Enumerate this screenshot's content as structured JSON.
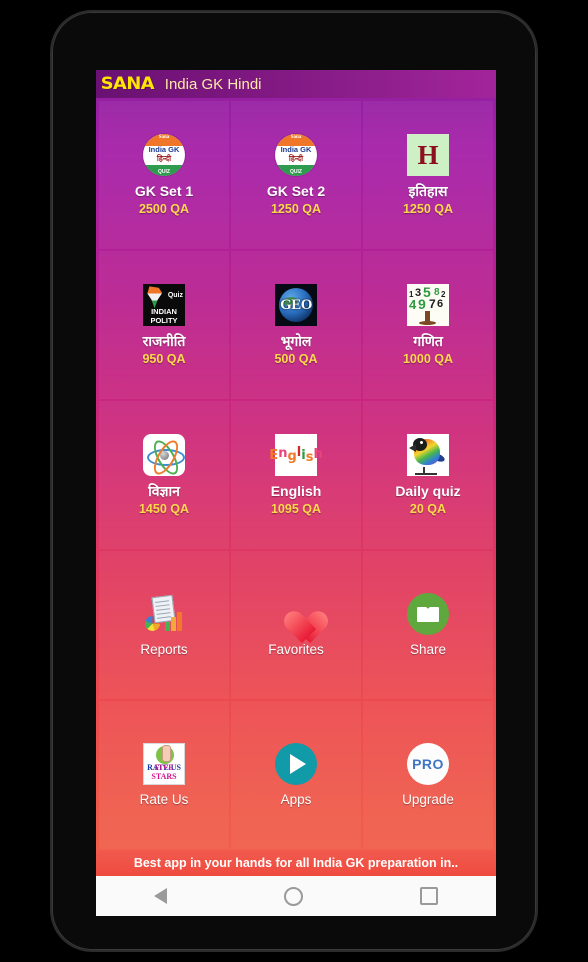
{
  "header": {
    "logo": "SANA",
    "title": "India GK Hindi"
  },
  "tiles": [
    {
      "id": "gk-set-1",
      "label": "GK Set 1",
      "count": "2500 QA",
      "icon": "india-gk-hindi-quiz-badge-icon"
    },
    {
      "id": "gk-set-2",
      "label": "GK Set 2",
      "count": "1250 QA",
      "icon": "india-gk-hindi-quiz-badge-icon"
    },
    {
      "id": "itihas",
      "label": "इतिहास",
      "count": "1250 QA",
      "icon": "history-h-icon"
    },
    {
      "id": "rajniti",
      "label": "राजनीति",
      "count": "950 QA",
      "icon": "indian-polity-quiz-icon"
    },
    {
      "id": "bhugol",
      "label": "भूगोल",
      "count": "500 QA",
      "icon": "geo-globe-icon"
    },
    {
      "id": "ganit",
      "label": "गणित",
      "count": "1000 QA",
      "icon": "numbers-tree-icon"
    },
    {
      "id": "vigyan",
      "label": "विज्ञान",
      "count": "1450 QA",
      "icon": "atom-icon"
    },
    {
      "id": "english",
      "label": "English",
      "count": "1095 QA",
      "icon": "english-letters-icon"
    },
    {
      "id": "daily-quiz",
      "label": "Daily quiz",
      "count": "20 QA",
      "icon": "parrot-icon"
    },
    {
      "id": "reports",
      "label": "Reports",
      "count": "",
      "icon": "reports-chart-icon"
    },
    {
      "id": "favorites",
      "label": "Favorites",
      "count": "",
      "icon": "heart-icon"
    },
    {
      "id": "share",
      "label": "Share",
      "count": "",
      "icon": "envelope-icon"
    },
    {
      "id": "rate-us",
      "label": "Rate Us",
      "count": "",
      "icon": "rate-us-five-stars-icon"
    },
    {
      "id": "apps",
      "label": "Apps",
      "count": "",
      "icon": "play-store-icon"
    },
    {
      "id": "upgrade",
      "label": "Upgrade",
      "count": "",
      "icon": "pro-badge-icon"
    }
  ],
  "icon_text": {
    "gk_sana": "Sana",
    "gk_line1": "India GK",
    "gk_line2": "हिन्दी",
    "gk_quiz": "QUIZ",
    "history_letter": "H",
    "polity_quiz": "Quiz",
    "polity_name": "INDIAN POLITY",
    "geo": "GEO",
    "math_numbers": [
      "1",
      "3",
      "5",
      "8",
      "2",
      "4",
      "9",
      "7",
      "6"
    ],
    "english": "English",
    "rate_line1": "RATE US",
    "rate_line2": "FIVE STARS",
    "pro": "PRO"
  },
  "banner": {
    "text": "Best app in your hands for all India GK preparation in.."
  },
  "navbar": {
    "back": "back-triangle",
    "home": "home-circle",
    "recents": "recents-square"
  },
  "colors": {
    "accent_yellow": "#ffd84d",
    "logo_yellow": "#ffe600",
    "appbar_purple": "#8f1f8d",
    "banner_red": "#ef4b3f",
    "bg_top": "#8e1f9e",
    "bg_bottom": "#f26048"
  }
}
